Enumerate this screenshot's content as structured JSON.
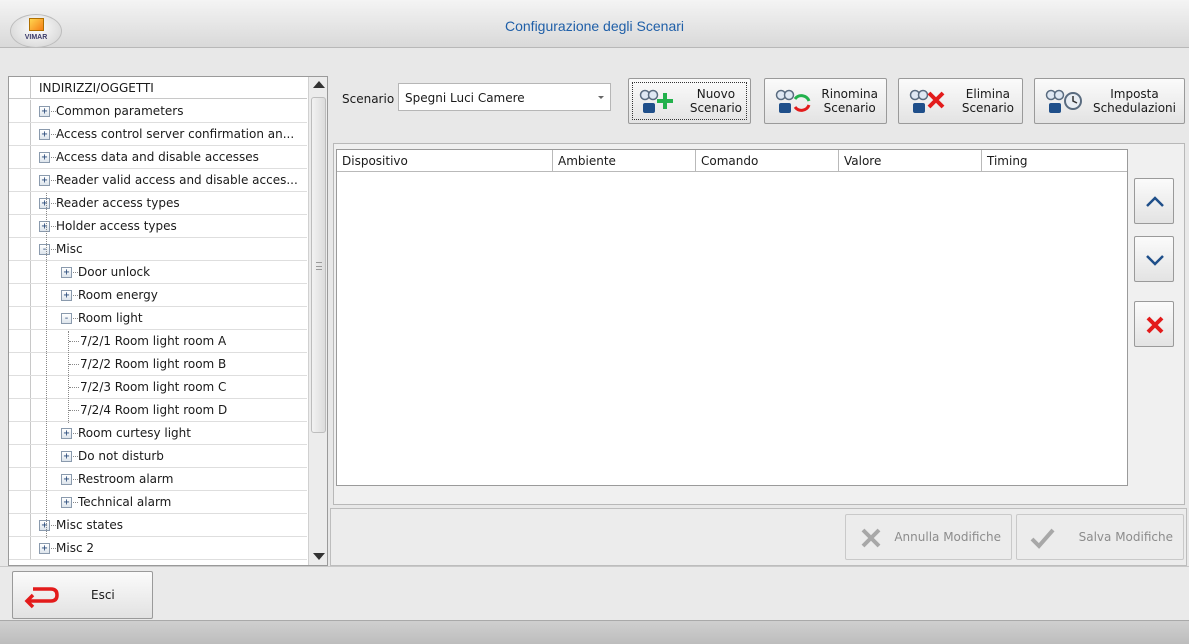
{
  "window": {
    "title": "Configurazione degli Scenari",
    "logo_text": "VIMAR"
  },
  "tree": {
    "header": "INDIRIZZI/OGGETTI",
    "items": [
      {
        "label": "Common parameters",
        "level": 0,
        "expander": "+"
      },
      {
        "label": "Access control server confirmation an...",
        "level": 0,
        "expander": "+"
      },
      {
        "label": "Access data and disable accesses",
        "level": 0,
        "expander": "+"
      },
      {
        "label": "Reader valid access and disable acces...",
        "level": 0,
        "expander": "+"
      },
      {
        "label": "Reader access types",
        "level": 0,
        "expander": "+"
      },
      {
        "label": "Holder access types",
        "level": 0,
        "expander": "+"
      },
      {
        "label": "Misc",
        "level": 0,
        "expander": "-"
      },
      {
        "label": "Door unlock",
        "level": 1,
        "expander": "+"
      },
      {
        "label": "Room energy",
        "level": 1,
        "expander": "+"
      },
      {
        "label": "Room light",
        "level": 1,
        "expander": "-"
      },
      {
        "label": "7/2/1 Room light room A",
        "level": 2,
        "expander": ""
      },
      {
        "label": "7/2/2 Room light room B",
        "level": 2,
        "expander": ""
      },
      {
        "label": "7/2/3 Room light room C",
        "level": 2,
        "expander": ""
      },
      {
        "label": "7/2/4 Room light room D",
        "level": 2,
        "expander": ""
      },
      {
        "label": "Room curtesy light",
        "level": 1,
        "expander": "+"
      },
      {
        "label": "Do not disturb",
        "level": 1,
        "expander": "+"
      },
      {
        "label": "Restroom alarm",
        "level": 1,
        "expander": "+"
      },
      {
        "label": "Technical alarm",
        "level": 1,
        "expander": "+"
      },
      {
        "label": "Misc states",
        "level": 0,
        "expander": "+"
      },
      {
        "label": "Misc 2",
        "level": 0,
        "expander": "+"
      }
    ]
  },
  "scenario": {
    "label": "Scenario",
    "selected": "Spegni Luci Camere",
    "buttons": {
      "new_line1": "Nuovo",
      "new_line2": "Scenario",
      "rename_line1": "Rinomina",
      "rename_line2": "Scenario",
      "delete_line1": "Elimina",
      "delete_line2": "Scenario",
      "schedule_line1": "Imposta",
      "schedule_line2": "Schedulazioni"
    }
  },
  "table": {
    "columns": [
      "Dispositivo",
      "Ambiente",
      "Comando",
      "Valore",
      "Timing"
    ],
    "rows": []
  },
  "actions": {
    "cancel": "Annulla Modifiche",
    "save": "Salva Modifiche"
  },
  "footer": {
    "exit": "Esci"
  },
  "colors": {
    "title": "#1f5fa8",
    "delete_red": "#e31b1b",
    "add_green": "#22b14c",
    "action_blue": "#1f4f8a"
  }
}
